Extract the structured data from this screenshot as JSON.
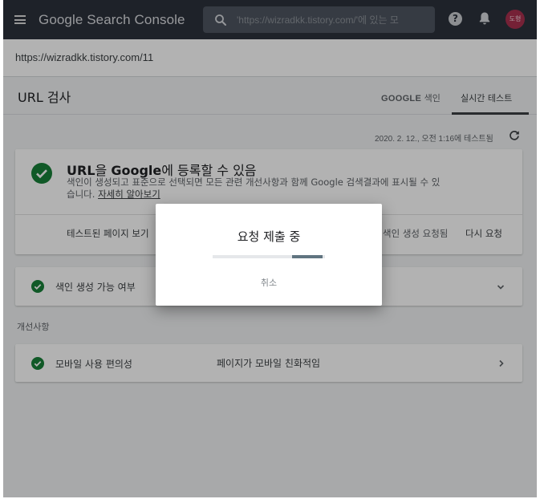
{
  "header": {
    "product_title": "Google Search Console",
    "search_value": "'https://wizradkk.tistory.com/'에 있는 모",
    "help_glyph": "?",
    "avatar_initials": "도형"
  },
  "url_bar": {
    "url": "https://wizradkk.tistory.com/11"
  },
  "page": {
    "title": "URL 검사",
    "tabs": [
      {
        "strong": "GOOGLE",
        "rest": " 색인"
      },
      {
        "label": "실시간 테스트",
        "selected": true
      }
    ],
    "timestamp": "2020. 2. 12., 오전 1:16에 테스트됨"
  },
  "status_card": {
    "title_strong_1": "URL",
    "title_lite_1": "을 ",
    "title_strong_2": "Google",
    "title_lite_2": "에 등록할 수 있음",
    "description": "색인이 생성되고 표준으로 선택되면 모든 관련 개선사항과 함께 Google 검색결과에 표시될 수 있습니다. ",
    "link": "자세히 알아보기",
    "view_tested_page": "테스트된 페이지 보기",
    "indexing_status": "색인 생성 요청됨",
    "retry": "다시 요청"
  },
  "index_row": {
    "label": "색인 생성 가능 여부"
  },
  "section": {
    "label": "개선사항"
  },
  "mobile_row": {
    "label": "모바일 사용 편의성",
    "value": "페이지가 모바일 친화적임"
  },
  "dialog": {
    "title": "요청 제출 중",
    "progress_start": 0.71,
    "progress_end": 0.98,
    "cancel": "취소"
  },
  "colors": {
    "topbar": "#2b313b",
    "success_green": "#188038",
    "avatar": "#a8304e",
    "progress": "#607480"
  }
}
